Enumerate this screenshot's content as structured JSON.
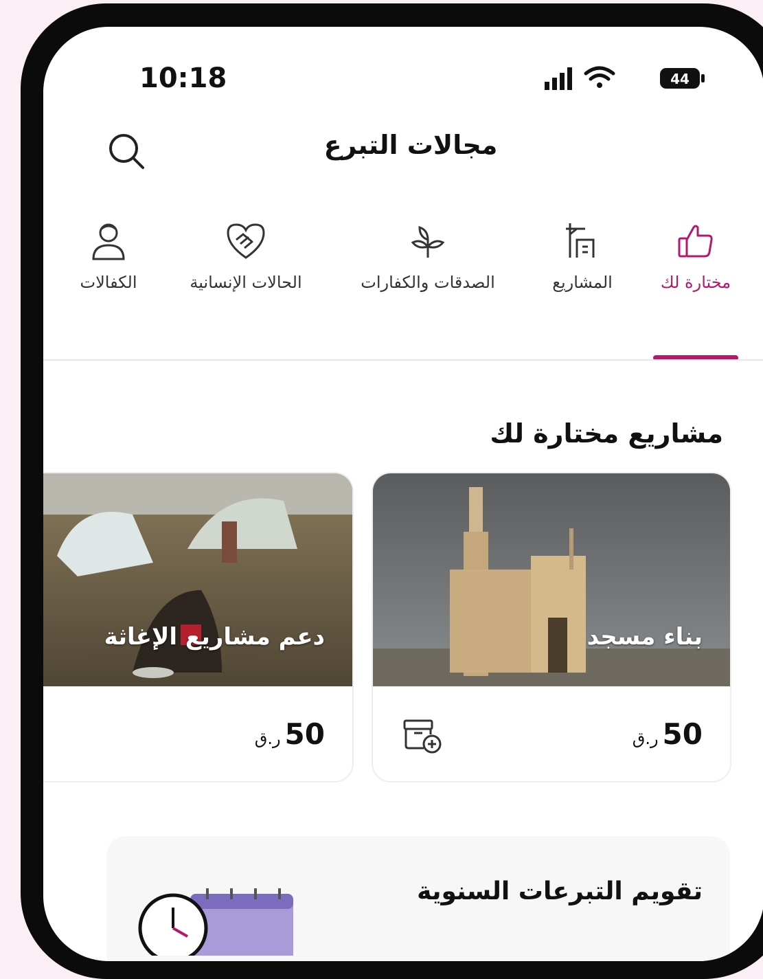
{
  "status_bar": {
    "time": "10:18",
    "battery": "44"
  },
  "header": {
    "title": "مجالات التبرع"
  },
  "tabs": [
    {
      "label": "مختارة لك",
      "icon": "thumbs-up-icon",
      "active": true
    },
    {
      "label": "المشاريع",
      "icon": "building-crane-icon",
      "active": false
    },
    {
      "label": "الصدقات والكفارات",
      "icon": "plant-leaves-icon",
      "active": false
    },
    {
      "label": "الحالات الإنسانية",
      "icon": "heart-handshake-icon",
      "active": false
    },
    {
      "label": "الكفالات",
      "icon": "person-icon",
      "active": false
    }
  ],
  "section": {
    "title": "مشاريع مختارة لك"
  },
  "cards": [
    {
      "title": "بناء مسجد",
      "amount": "50",
      "currency": "ر.ق"
    },
    {
      "title": "دعم مشاريع الإغاثة",
      "amount": "50",
      "currency": "ر.ق"
    }
  ],
  "calendar": {
    "title": "تقويم التبرعات السنوية"
  },
  "colors": {
    "accent": "#b5186a",
    "background": "#fbeef5"
  }
}
